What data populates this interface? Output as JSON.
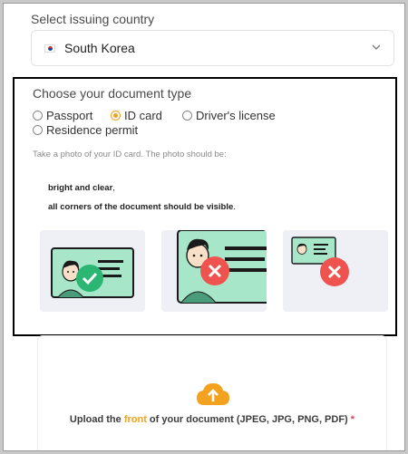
{
  "country": {
    "label": "Select issuing country",
    "value": "South Korea",
    "flag_icon": "south-korea-flag-icon",
    "chevron_icon": "chevron-down-icon"
  },
  "document": {
    "title": "Choose your document type",
    "options": [
      {
        "label": "Passport",
        "checked": false
      },
      {
        "label": "ID card",
        "checked": true
      },
      {
        "label": "Driver's license",
        "checked": false
      },
      {
        "label": "Residence permit",
        "checked": false
      }
    ],
    "hint": "Take a photo of your ID card. The photo should be:",
    "requirement_1_bold": "bright and clear",
    "requirement_1_tail": ",",
    "requirement_2_bold": "all corners of the document should be visible",
    "requirement_2_tail": ".",
    "examples": [
      {
        "status": "correct",
        "icon": "check-icon"
      },
      {
        "status": "too-close",
        "icon": "cross-icon"
      },
      {
        "status": "too-far",
        "icon": "cross-icon"
      }
    ]
  },
  "upload": {
    "icon": "cloud-upload-icon",
    "text_before": "Upload the ",
    "text_accent": "front",
    "text_after": " of your document (JPEG, JPG, PNG, PDF) ",
    "required_mark": "*"
  },
  "colors": {
    "accent": "#f2a21f",
    "success": "#2bb673",
    "error": "#ef5350",
    "card_green": "#a8e6c9"
  }
}
